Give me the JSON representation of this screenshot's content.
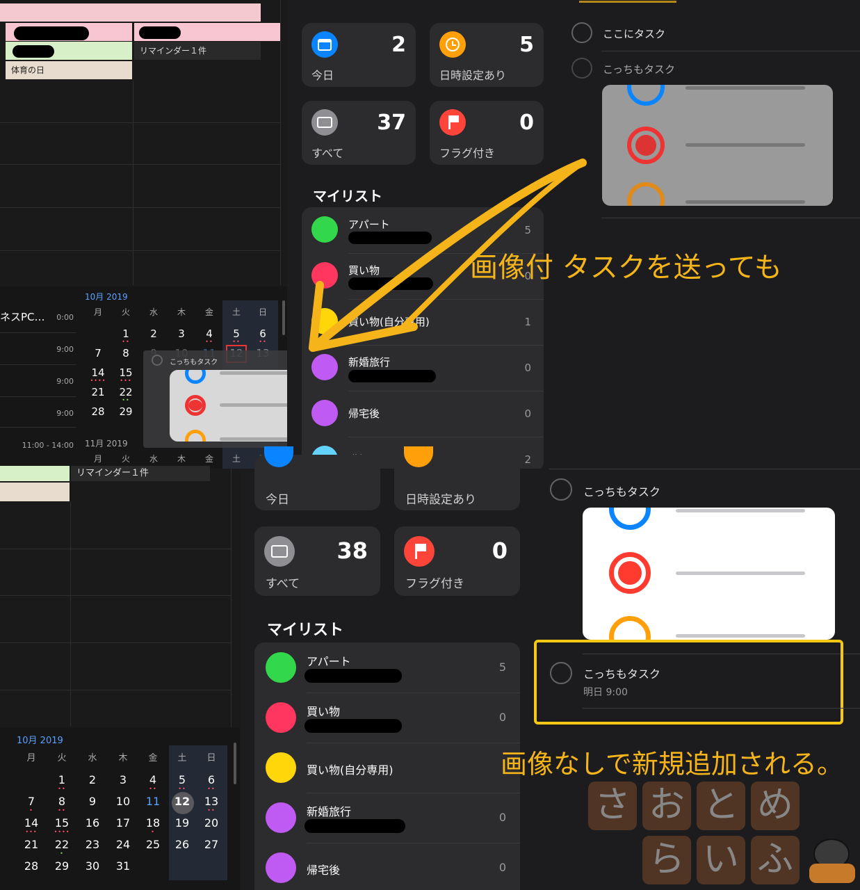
{
  "top_calendar": {
    "events": {
      "holiday": "体育の日",
      "reminder": "リマインダー１件"
    },
    "partial_event": "ネスPC…",
    "times": [
      "0:00",
      "9:00",
      "9:00",
      "9:00",
      "11:00 - 14:00"
    ],
    "oct_label": "10月 2019",
    "nov_label": "11月 2019",
    "weekdays": [
      "月",
      "火",
      "水",
      "木",
      "金",
      "土",
      "日"
    ],
    "drag_preview_title": "こっちもタスク"
  },
  "bottom_calendar": {
    "reminder": "リマインダー１件",
    "oct_label": "10月 2019",
    "weekdays": [
      "月",
      "火",
      "水",
      "木",
      "金",
      "土",
      "日"
    ]
  },
  "top_sidebar": {
    "tiles": {
      "today": {
        "label": "今日",
        "count": "2"
      },
      "scheduled": {
        "label": "日時設定あり",
        "count": "5"
      },
      "all": {
        "label": "すべて",
        "count": "37"
      },
      "flagged": {
        "label": "フラグ付き",
        "count": "0"
      }
    },
    "my_lists_title": "マイリスト",
    "lists": [
      {
        "name": "アパート",
        "count": "5"
      },
      {
        "name": "買い物",
        "count": "0"
      },
      {
        "name": "買い物(自分専用)",
        "count": "1"
      },
      {
        "name": "新婚旅行",
        "count": "0"
      },
      {
        "name": "帰宅後",
        "count": "0"
      },
      {
        "name": "職場",
        "count": "2"
      }
    ]
  },
  "bottom_sidebar": {
    "tiles": {
      "today": {
        "label": "今日"
      },
      "scheduled": {
        "label": "日時設定あり"
      },
      "all": {
        "label": "すべて",
        "count": "38"
      },
      "flagged": {
        "label": "フラグ付き",
        "count": "0"
      }
    },
    "my_lists_title": "マイリスト",
    "lists": [
      {
        "name": "アパート",
        "count": "5"
      },
      {
        "name": "買い物",
        "count": "0"
      },
      {
        "name": "買い物(自分専用)",
        "count": ""
      },
      {
        "name": "新婚旅行",
        "count": "0"
      },
      {
        "name": "帰宅後",
        "count": "0"
      }
    ]
  },
  "top_tasks": {
    "task1": "ここにタスク",
    "task2": "こっちもタスク"
  },
  "bottom_tasks": {
    "task1": "こっちもタスク",
    "task2": "こっちもタスク",
    "task2_due": "明日 9:00"
  },
  "annotations": {
    "top": "画像付 タスクを送っても",
    "bottom": "画像なしで新規追加される。"
  },
  "logo": {
    "chars": [
      "さ",
      "お",
      "と",
      "め",
      "ら",
      "い",
      "ふ"
    ]
  },
  "colors": {
    "annotation": "#f5b51a",
    "blue": "#0a84ff",
    "orange": "#ff9f0a",
    "gray": "#8e8e93",
    "red": "#ff453a",
    "green": "#32d74b",
    "pink": "#ff375f",
    "yellow": "#ffd60a",
    "purple": "#bf5af2",
    "cyan": "#64d2ff"
  }
}
